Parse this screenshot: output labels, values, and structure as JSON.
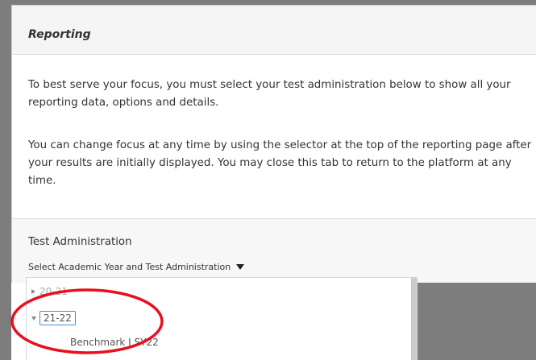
{
  "panel": {
    "title": "Reporting",
    "paragraph1": "To best serve your focus, you must select your test administration below to show all your reporting data, options and details.",
    "paragraph2": "You can change focus at any time by using the selector at the top of the reporting page after your results are initially displayed. You may close this tab to return to the platform at any time."
  },
  "test_admin": {
    "label": "Test Administration",
    "select_label": "Select Academic Year and Test Administration"
  },
  "dropdown": {
    "items": [
      {
        "label": "20-21",
        "expanded": false
      },
      {
        "label": "21-22",
        "expanded": true,
        "children": [
          "Benchmark I SY22"
        ]
      }
    ]
  },
  "annotation": {
    "highlight_color": "#e8101e"
  }
}
